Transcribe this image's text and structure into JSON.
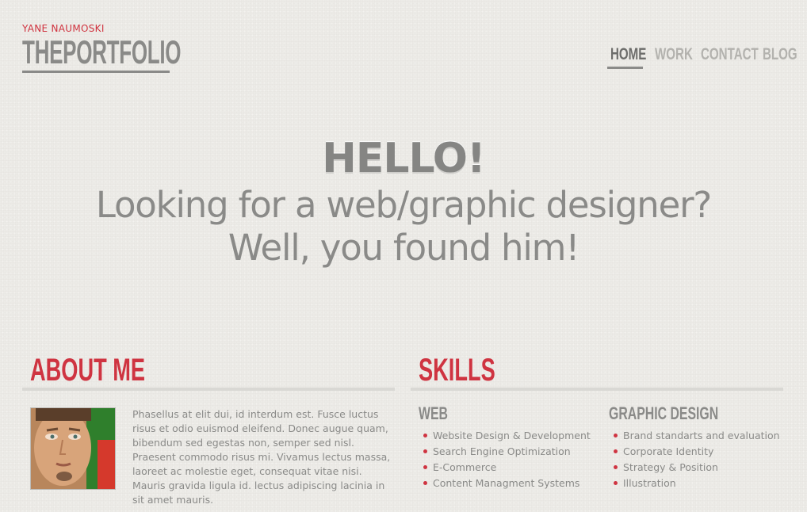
{
  "header": {
    "owner_name": "YANE NAUMOSKI",
    "logo_text": "THEPORTFOLIO"
  },
  "nav": {
    "items": [
      {
        "label": "HOME",
        "active": true
      },
      {
        "label": "WORK",
        "active": false
      },
      {
        "label": "CONTACT",
        "active": false
      },
      {
        "label": "BLOG",
        "active": false
      }
    ]
  },
  "hero": {
    "greeting": "HELLO!",
    "line1": "Looking for a web/graphic designer?",
    "line2": "Well, you found him!"
  },
  "about": {
    "title": "ABOUT ME",
    "body": "Phasellus at elit dui, id interdum est. Fusce luctus risus et odio euismod eleifend. Donec augue quam, bibendum sed egestas non, semper sed nisl. Praesent commodo risus mi. Vivamus lectus massa, laoreet ac molestie eget, consequat vitae nisi. Mauris gravida ligula id. lectus adipiscing lacinia in sit amet mauris."
  },
  "skills": {
    "title": "SKILLS",
    "web": {
      "heading": "WEB",
      "items": [
        "Website Design & Development",
        "Search Engine Optimization",
        "E-Commerce",
        "Content Managment Systems"
      ]
    },
    "graphic": {
      "heading": "GRAPHIC DESIGN",
      "items": [
        "Brand standarts and evaluation",
        "Corporate Identity",
        "Strategy & Position",
        "Illustration"
      ]
    }
  },
  "colors": {
    "accent": "#cf3441",
    "text": "#8a8a88",
    "background": "#ecebe7"
  }
}
